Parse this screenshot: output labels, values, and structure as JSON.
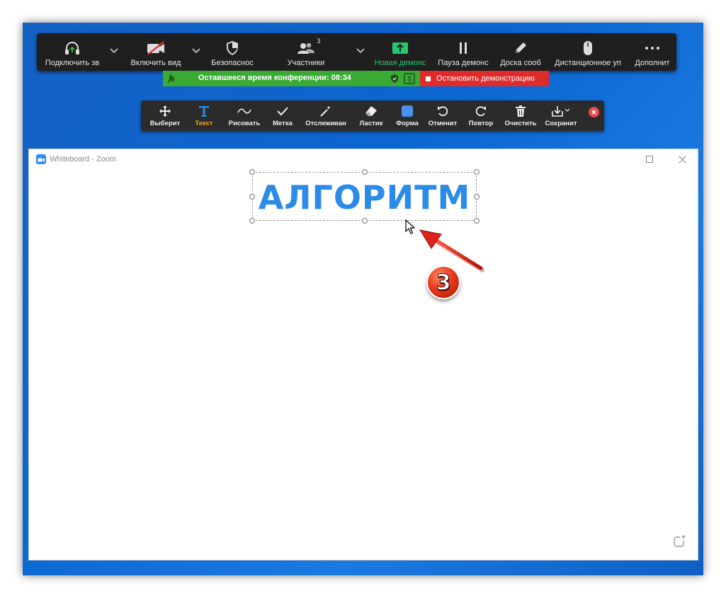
{
  "meeting_toolbar": {
    "items": [
      {
        "label": "Подключить зв",
        "icon": "headphones-icon"
      },
      {
        "label": "Включить вид",
        "icon": "video-off-icon"
      },
      {
        "label": "Безопаснос",
        "icon": "shield-icon"
      },
      {
        "label": "Участники",
        "icon": "participants-icon",
        "count": "3"
      },
      {
        "label": "Новая демонс",
        "icon": "share-screen-icon"
      },
      {
        "label": "Пауза демонс",
        "icon": "pause-icon"
      },
      {
        "label": "Доска сооб",
        "icon": "pencil-icon"
      },
      {
        "label": "Дистанционное уп",
        "icon": "mouse-icon"
      },
      {
        "label": "Дополнит",
        "icon": "more-icon"
      }
    ]
  },
  "status": {
    "time_remaining": "Оставшееся время конференции: 08:34",
    "stop_share": "Остановить демонстрацию"
  },
  "annotation_toolbar": {
    "items": [
      {
        "label": "Выберит",
        "icon": "move-icon"
      },
      {
        "label": "Текст",
        "icon": "text-icon",
        "active": true
      },
      {
        "label": "Рисовать",
        "icon": "draw-icon"
      },
      {
        "label": "Метка",
        "icon": "checkmark-icon"
      },
      {
        "label": "Отслеживан",
        "icon": "spotlight-icon"
      },
      {
        "label": "Ластик",
        "icon": "eraser-icon"
      },
      {
        "label": "Форма",
        "icon": "shape-icon"
      },
      {
        "label": "Отменит",
        "icon": "undo-icon"
      },
      {
        "label": "Повтор",
        "icon": "redo-icon"
      },
      {
        "label": "Очистить",
        "icon": "trash-icon"
      },
      {
        "label": "Сохранит",
        "icon": "save-icon"
      }
    ]
  },
  "whiteboard": {
    "title": "Whiteboard - Zoom",
    "text": "АЛГОРИТМ"
  },
  "annotation": {
    "step": "3"
  },
  "colors": {
    "accent": "#2d8be8",
    "share_green": "#28c76f",
    "status_green": "#3aaa34",
    "stop_red": "#e02b2b",
    "active_tool": "#f5a623"
  }
}
